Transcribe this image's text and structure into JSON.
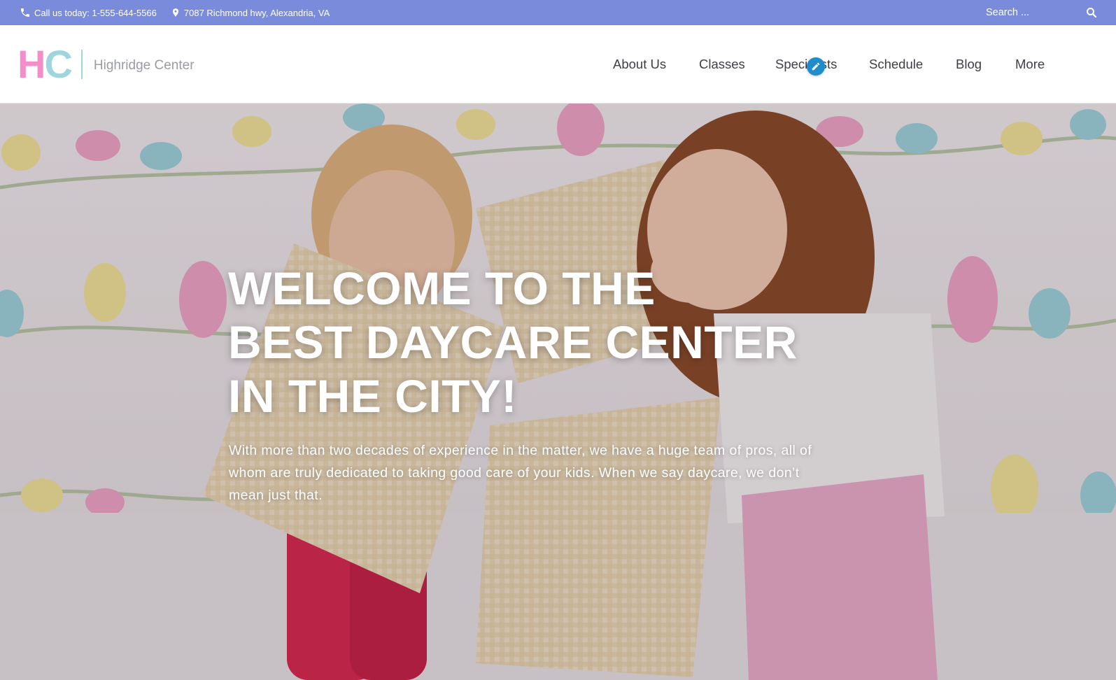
{
  "topbar": {
    "phone": "Call us today: 1-555-644-5566",
    "address": "7087 Richmond hwy, Alexandria, VA",
    "search_placeholder": "Search ..."
  },
  "header": {
    "logo_letters": [
      "H",
      "C"
    ],
    "site_name": "Highridge Center",
    "nav": [
      "About Us",
      "Classes",
      "Specialists",
      "Schedule",
      "Blog",
      "More"
    ]
  },
  "hero": {
    "title_lines": [
      "WELCOME TO THE",
      "BEST DAYCARE CENTER",
      "IN THE CITY!"
    ],
    "text": "With more than two decades of experience in the matter, we have a huge team of pros, all of whom are truly dedicated to taking good care of your kids. When we say daycare, we don’t mean just that."
  },
  "colors": {
    "topbar_bg": "#7b8bdb",
    "logo_h": "#f48ec8",
    "logo_c": "#9fd6de",
    "nav_text": "#3d3f45",
    "edit_badge": "#1f8dcc"
  },
  "icons": [
    "phone-icon",
    "location-pin-icon",
    "search-icon",
    "pencil-icon"
  ]
}
